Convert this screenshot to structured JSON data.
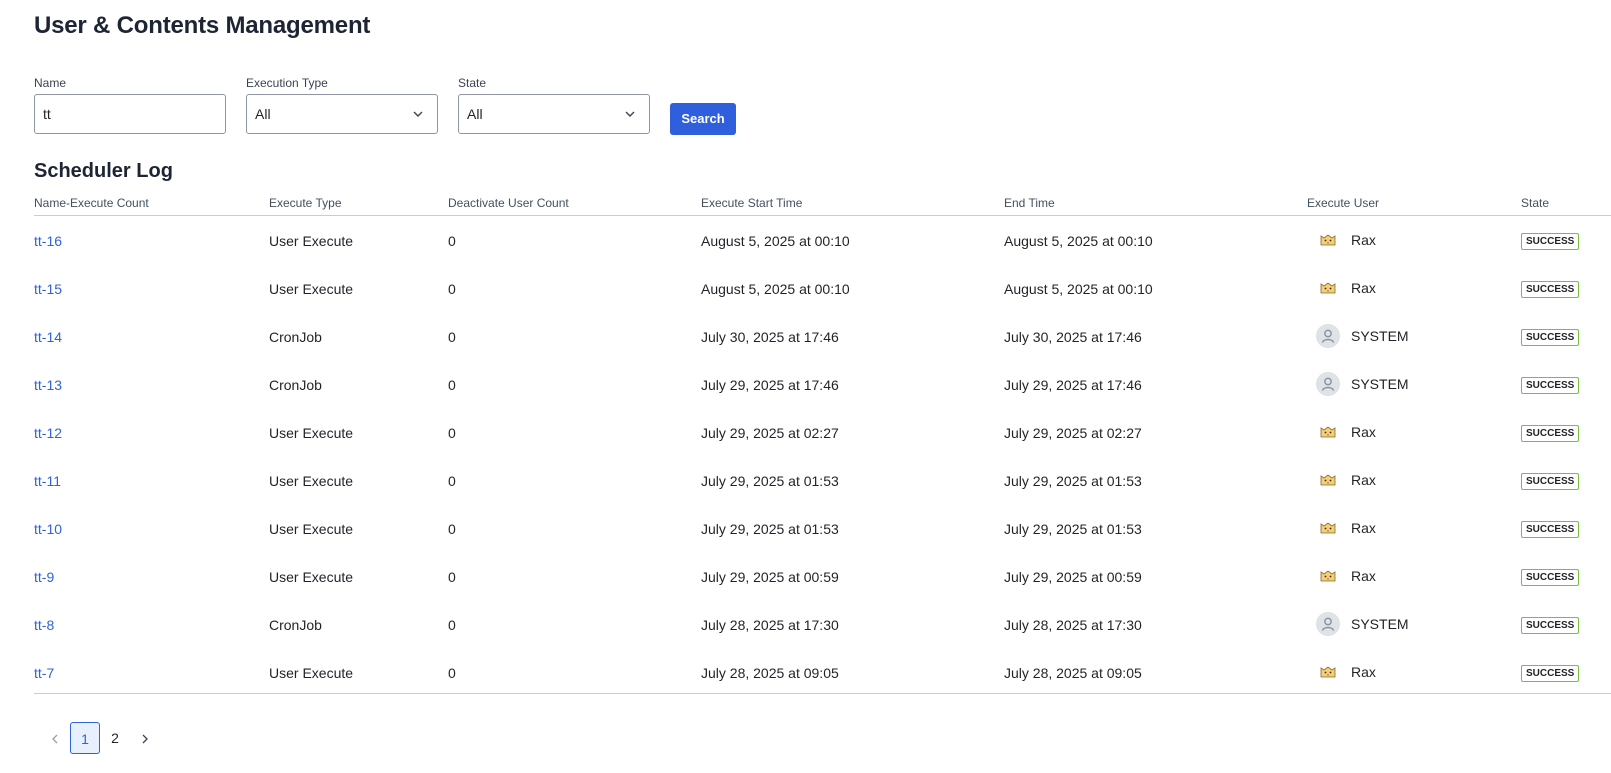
{
  "page": {
    "title": "User & Contents Management"
  },
  "filters": {
    "name_label": "Name",
    "name_value": "tt",
    "execution_type_label": "Execution Type",
    "execution_type_value": "All",
    "state_label": "State",
    "state_value": "All",
    "search_label": "Search"
  },
  "section": {
    "title": "Scheduler Log"
  },
  "table": {
    "columns": [
      "Name-Execute Count",
      "Execute Type",
      "Deactivate User Count",
      "Execute Start Time",
      "End Time",
      "Execute User",
      "State"
    ],
    "rows": [
      {
        "name": "tt-16",
        "type": "User Execute",
        "count": "0",
        "start": "August 5, 2025 at 00:10",
        "end": "August 5, 2025 at 00:10",
        "user": "Rax",
        "avatar": "cat-avatar",
        "state": "SUCCESS"
      },
      {
        "name": "tt-15",
        "type": "User Execute",
        "count": "0",
        "start": "August 5, 2025 at 00:10",
        "end": "August 5, 2025 at 00:10",
        "user": "Rax",
        "avatar": "cat-avatar",
        "state": "SUCCESS"
      },
      {
        "name": "tt-14",
        "type": "CronJob",
        "count": "0",
        "start": "July 30, 2025 at 17:46",
        "end": "July 30, 2025 at 17:46",
        "user": "SYSTEM",
        "avatar": "person-icon",
        "state": "SUCCESS"
      },
      {
        "name": "tt-13",
        "type": "CronJob",
        "count": "0",
        "start": "July 29, 2025 at 17:46",
        "end": "July 29, 2025 at 17:46",
        "user": "SYSTEM",
        "avatar": "person-icon",
        "state": "SUCCESS"
      },
      {
        "name": "tt-12",
        "type": "User Execute",
        "count": "0",
        "start": "July 29, 2025 at 02:27",
        "end": "July 29, 2025 at 02:27",
        "user": "Rax",
        "avatar": "cat-avatar",
        "state": "SUCCESS"
      },
      {
        "name": "tt-11",
        "type": "User Execute",
        "count": "0",
        "start": "July 29, 2025 at 01:53",
        "end": "July 29, 2025 at 01:53",
        "user": "Rax",
        "avatar": "cat-avatar",
        "state": "SUCCESS"
      },
      {
        "name": "tt-10",
        "type": "User Execute",
        "count": "0",
        "start": "July 29, 2025 at 01:53",
        "end": "July 29, 2025 at 01:53",
        "user": "Rax",
        "avatar": "cat-avatar",
        "state": "SUCCESS"
      },
      {
        "name": "tt-9",
        "type": "User Execute",
        "count": "0",
        "start": "July 29, 2025 at 00:59",
        "end": "July 29, 2025 at 00:59",
        "user": "Rax",
        "avatar": "cat-avatar",
        "state": "SUCCESS"
      },
      {
        "name": "tt-8",
        "type": "CronJob",
        "count": "0",
        "start": "July 28, 2025 at 17:30",
        "end": "July 28, 2025 at 17:30",
        "user": "SYSTEM",
        "avatar": "person-icon",
        "state": "SUCCESS"
      },
      {
        "name": "tt-7",
        "type": "User Execute",
        "count": "0",
        "start": "July 28, 2025 at 09:05",
        "end": "July 28, 2025 at 09:05",
        "user": "Rax",
        "avatar": "cat-avatar",
        "state": "SUCCESS"
      }
    ]
  },
  "pagination": {
    "pages": [
      "1",
      "2"
    ],
    "current": "1",
    "prev_icon": "chevron-left-icon",
    "next_icon": "chevron-right-icon"
  },
  "colors": {
    "accent": "#2f5fdc",
    "link": "#2f63d6",
    "success_border": "#74c044"
  }
}
